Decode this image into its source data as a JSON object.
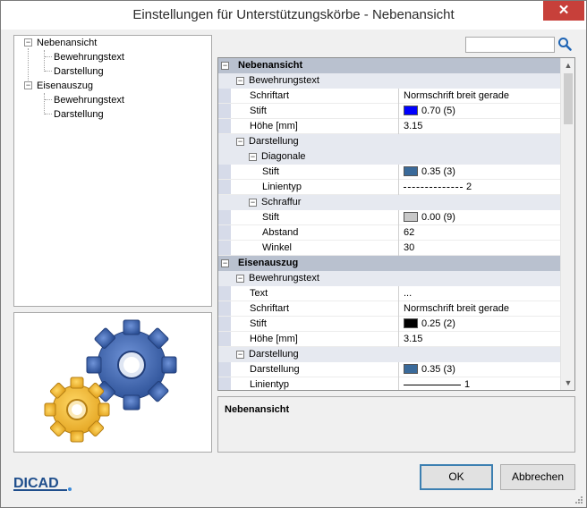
{
  "window": {
    "title": "Einstellungen für Unterstützungskörbe - Nebenansicht",
    "close_glyph": "✕"
  },
  "tree": {
    "items": [
      {
        "label": "Nebenansicht",
        "toggle": "−"
      },
      {
        "label": "Bewehrungstext"
      },
      {
        "label": "Darstellung"
      },
      {
        "label": "Eisenauszug",
        "toggle": "−"
      },
      {
        "label": "Bewehrungstext"
      },
      {
        "label": "Darstellung"
      }
    ]
  },
  "search": {
    "value": "",
    "placeholder": "",
    "icon": "search-icon"
  },
  "grid": {
    "toggle_glyph": "−",
    "rows": [
      {
        "name": "Nebenansicht"
      },
      {
        "name": "Bewehrungstext"
      },
      {
        "name": "Schriftart",
        "value": "Normschrift breit gerade"
      },
      {
        "name": "Stift",
        "value": "0.70 (5)",
        "color": "#0000ff"
      },
      {
        "name": "Höhe [mm]",
        "value": "3.15"
      },
      {
        "name": "Darstellung"
      },
      {
        "name": "Diagonale"
      },
      {
        "name": "Stift",
        "value": "0.35 (3)",
        "color": "#3a6a9a"
      },
      {
        "name": "Linientyp",
        "value": "2",
        "line": "dashed"
      },
      {
        "name": "Schraffur"
      },
      {
        "name": "Stift",
        "value": "0.00 (9)",
        "color": "#c8c8c8"
      },
      {
        "name": "Abstand",
        "value": "62"
      },
      {
        "name": "Winkel",
        "value": "30"
      },
      {
        "name": "Eisenauszug"
      },
      {
        "name": "Bewehrungstext"
      },
      {
        "name": "Text",
        "value": "..."
      },
      {
        "name": "Schriftart",
        "value": "Normschrift breit gerade"
      },
      {
        "name": "Stift",
        "value": "0.25 (2)",
        "color": "#000000"
      },
      {
        "name": "Höhe [mm]",
        "value": "3.15"
      },
      {
        "name": "Darstellung"
      },
      {
        "name": "Darstellung",
        "value": "0.35 (3)",
        "color": "#3a6a9a"
      },
      {
        "name": "Linientyp",
        "value": "1",
        "line": "solid"
      }
    ],
    "scroll_up": "▲",
    "scroll_down": "▼"
  },
  "description": {
    "title": "Nebenansicht"
  },
  "buttons": {
    "ok": "OK",
    "cancel": "Abbrechen"
  },
  "logo": {
    "text": "DICAD"
  },
  "colors": {
    "gear_blue": "#3a5fa8",
    "gear_yellow": "#f2b632",
    "category_bg": "#b9c1cf",
    "close_red": "#c7403a"
  }
}
